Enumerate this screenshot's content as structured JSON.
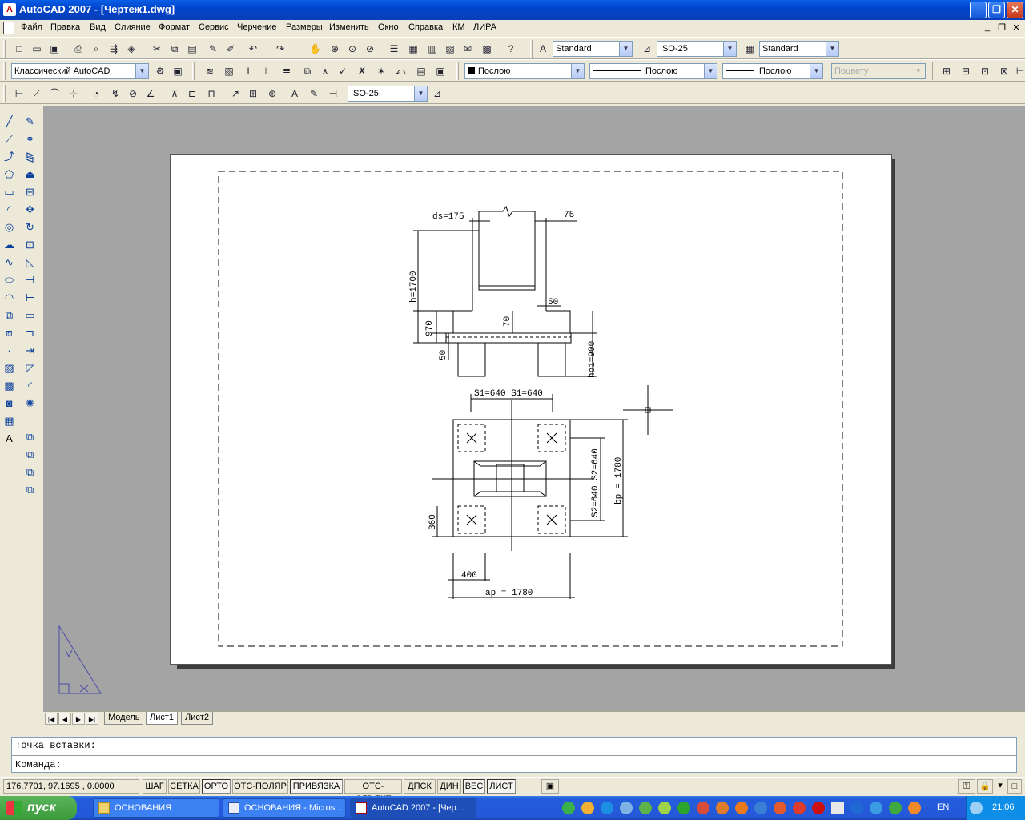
{
  "window": {
    "title": "AutoCAD 2007 - [Чертеж1.dwg]",
    "controls": [
      "_",
      "❐",
      "✕"
    ]
  },
  "menu": {
    "items": [
      "Файл",
      "Правка",
      "Вид",
      "Слияние",
      "Формат",
      "Сервис",
      "Черчение",
      "Размеры",
      "Изменить",
      "Окно",
      "Справка",
      "КМ",
      "ЛИРА"
    ],
    "mdi_controls": [
      "_",
      "❐",
      "✕"
    ]
  },
  "toolbar_styles": {
    "text_style": "Standard",
    "dim_style": "ISO-25",
    "table_style": "Standard"
  },
  "toolbar_workspace": {
    "workspace": "Классический AutoCAD",
    "color": "Послою",
    "linetype": "Послою",
    "lineweight": "Послою",
    "plotstyle": "Поцвету"
  },
  "toolbar_dims": {
    "dim_style": "ISO-25"
  },
  "tabs": {
    "model": "Модель",
    "sheet1": "Лист1",
    "sheet2": "Лист2"
  },
  "command": {
    "line1": "Точка вставки:",
    "line2": "Команда:"
  },
  "status": {
    "coords": "176.7701, 97.1695 , 0.0000",
    "buttons": [
      "ШАГ",
      "СЕТКА",
      "ОРТО",
      "ОТС-ПОЛЯР",
      "ПРИВЯЗКА",
      "ОТС-ОБЪЕКТ",
      "ДПСК",
      "ДИН",
      "ВЕС",
      "ЛИСТ"
    ],
    "active": [
      "ОРТО",
      "ПРИВЯЗКА",
      "ВЕС",
      "ЛИСТ"
    ]
  },
  "taskbar": {
    "start": "пуск",
    "tasks": [
      "ОСНОВАНИЯ",
      "ОСНОВАНИЯ - Micros...",
      "AutoCAD 2007 - [Чер..."
    ],
    "lang": "EN",
    "clock": "21:06"
  },
  "drawing": {
    "dims": {
      "ds": "ds=175",
      "d75": "75",
      "h": "h=1700",
      "d50a": "50",
      "d970": "970",
      "d70": "70",
      "d50b": "50",
      "ho1": "ho1=900",
      "s1": "S1=640 S1=640",
      "s2": "S2=640 S2=640",
      "bp": "bp = 1780",
      "d360": "360",
      "d400": "400",
      "ap": "ap = 1780"
    }
  }
}
